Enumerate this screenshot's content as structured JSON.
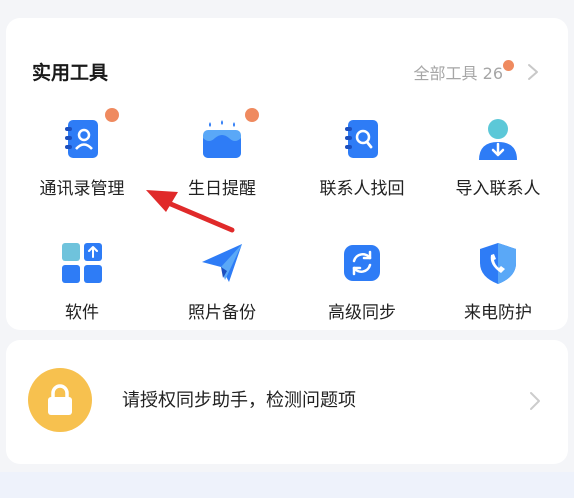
{
  "section": {
    "title": "实用工具",
    "all_tools_label": "全部工具 26"
  },
  "tools": [
    {
      "label": "通讯录管理",
      "icon": "contact-book-icon",
      "badge": true
    },
    {
      "label": "生日提醒",
      "icon": "birthday-cake-icon",
      "badge": true
    },
    {
      "label": "联系人找回",
      "icon": "contact-search-icon",
      "badge": false
    },
    {
      "label": "导入联系人",
      "icon": "import-contact-icon",
      "badge": false
    },
    {
      "label": "软件",
      "icon": "apps-icon",
      "badge": false
    },
    {
      "label": "照片备份",
      "icon": "paper-plane-icon",
      "badge": false
    },
    {
      "label": "高级同步",
      "icon": "sync-icon",
      "badge": false
    },
    {
      "label": "来电防护",
      "icon": "shield-phone-icon",
      "badge": false
    }
  ],
  "tip": {
    "text": "请授权同步助手，检测问题项",
    "icon": "lock-icon"
  },
  "colors": {
    "accent_blue": "#2e7cf6",
    "badge_orange": "#ef8a5f",
    "lock_yellow": "#f7c14f",
    "annotation_red": "#e02a2a"
  }
}
